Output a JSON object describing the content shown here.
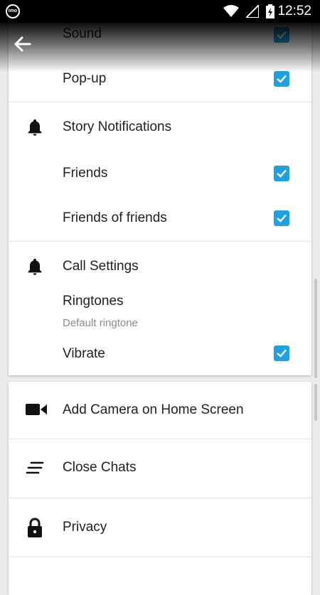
{
  "status_bar": {
    "app_icon": "imo",
    "icons": [
      "wifi-icon",
      "signal-icon",
      "battery-charging-icon"
    ],
    "time": "12:52"
  },
  "header": {
    "back_icon": "arrow-left-icon"
  },
  "notifications": {
    "sound_label": "Sound",
    "sound_checked": true,
    "popup_label": "Pop-up",
    "popup_checked": true
  },
  "story_notifications": {
    "section_icon": "bell-icon",
    "title": "Story Notifications",
    "friends_label": "Friends",
    "friends_checked": true,
    "fof_label": "Friends of friends",
    "fof_checked": true
  },
  "call_settings": {
    "section_icon": "bell-icon",
    "title": "Call Settings",
    "ringtones_label": "Ringtones",
    "ringtones_value": "Default ringtone",
    "vibrate_label": "Vibrate",
    "vibrate_checked": true
  },
  "menu": {
    "items": [
      {
        "icon": "video-camera-icon",
        "label": "Add Camera on Home Screen"
      },
      {
        "icon": "close-chats-icon",
        "label": "Close Chats"
      },
      {
        "icon": "lock-icon",
        "label": "Privacy"
      }
    ]
  },
  "colors": {
    "checkbox": "#1da1e2",
    "status_bar": "#000000"
  }
}
